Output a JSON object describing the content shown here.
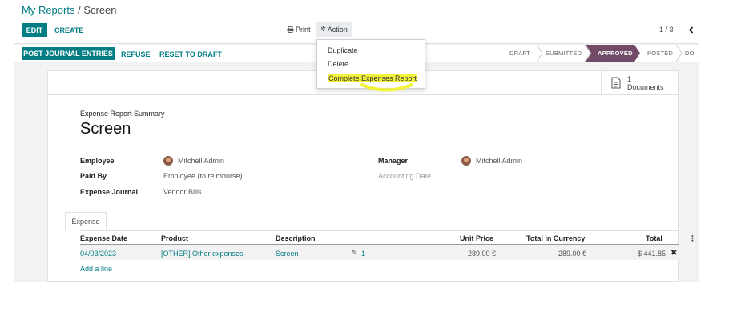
{
  "breadcrumb": {
    "parent": "My Reports",
    "separator": " / ",
    "current": "Screen"
  },
  "toolbar": {
    "edit": "EDIT",
    "create": "CREATE",
    "print": "Print",
    "action": "Action",
    "pager": "1 / 3"
  },
  "action_menu": {
    "items": [
      "Duplicate",
      "Delete",
      "Complete Expenses Report"
    ]
  },
  "status_buttons": {
    "post": "POST JOURNAL ENTRIES",
    "refuse": "REFUSE",
    "reset": "RESET TO DRAFT"
  },
  "stages": [
    "DRAFT",
    "SUBMITTED",
    "APPROVED",
    "POSTED",
    "DO"
  ],
  "active_stage": "APPROVED",
  "colors": {
    "primary": "#017e84",
    "stage_active": "#714b67",
    "highlight": "#f2f23a"
  },
  "documents": {
    "count": "1",
    "label": "Documents"
  },
  "form": {
    "subtitle": "Expense Report Summary",
    "title": "Screen",
    "employee_label": "Employee",
    "employee": "Mitchell Admin",
    "paid_by_label": "Paid By",
    "paid_by": "Employee (to reimburse)",
    "journal_label": "Expense Journal",
    "journal": "Vendor Bills",
    "manager_label": "Manager",
    "manager": "Mitchell Admin",
    "accounting_date_label": "Accounting Date"
  },
  "tabs": [
    "Expense"
  ],
  "table": {
    "headers": [
      "Expense Date",
      "Product",
      "Description",
      "Unit Price",
      "Total In Currency",
      "Total"
    ],
    "rows": [
      {
        "date": "04/03/2023",
        "product": "[OTHER] Other expenses",
        "description": "Screen",
        "attachments": "1",
        "unit_price": "289.00 €",
        "total_currency": "289.00 €",
        "total": "$ 441.85"
      }
    ],
    "add_line": "Add a line"
  }
}
